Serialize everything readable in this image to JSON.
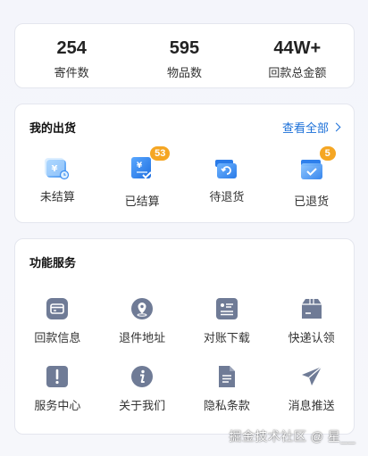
{
  "stats": [
    {
      "value": "254",
      "label": "寄件数"
    },
    {
      "value": "595",
      "label": "物品数"
    },
    {
      "value": "44W+",
      "label": "回款总金额"
    }
  ],
  "shipments": {
    "title": "我的出货",
    "view_all": "查看全部",
    "items": [
      {
        "label": "未结算",
        "icon": "unsettled-icon",
        "badge": ""
      },
      {
        "label": "已结算",
        "icon": "settled-icon",
        "badge": "53"
      },
      {
        "label": "待退货",
        "icon": "pending-return-icon",
        "badge": ""
      },
      {
        "label": "已退货",
        "icon": "returned-icon",
        "badge": "5"
      }
    ]
  },
  "services": {
    "title": "功能服务",
    "items": [
      {
        "label": "回款信息",
        "icon": "payment-card-icon"
      },
      {
        "label": "退件地址",
        "icon": "location-pin-icon"
      },
      {
        "label": "对账下载",
        "icon": "statement-icon"
      },
      {
        "label": "快递认领",
        "icon": "package-box-icon"
      },
      {
        "label": "服务中心",
        "icon": "alert-doc-icon"
      },
      {
        "label": "关于我们",
        "icon": "info-icon"
      },
      {
        "label": "隐私条款",
        "icon": "document-icon"
      },
      {
        "label": "消息推送",
        "icon": "paper-plane-icon"
      }
    ]
  },
  "colors": {
    "accent_blue": "#1a6fd8",
    "badge_orange": "#f5a623",
    "service_icon": "#6f7b96"
  },
  "watermark": "掘金技术社区 @ 星__"
}
